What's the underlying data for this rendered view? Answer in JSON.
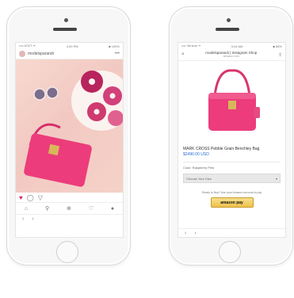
{
  "left_phone": {
    "status": {
      "carrier": "•••• AT&T ᯤ",
      "time": "4:20 PM",
      "battery": "■ 100%"
    },
    "header": {
      "username": "modelsparandi",
      "more": "•••"
    },
    "actions": {
      "like": "♥",
      "comment": "◯",
      "share": "▽"
    },
    "tabbar": [
      "⌂",
      "⚲",
      "⊕",
      "♡",
      "●"
    ],
    "nav": {
      "back": "‹",
      "forward": "›"
    }
  },
  "right_phone": {
    "status": {
      "carrier": "•••• Verizon ᯤ",
      "time": "9:44 AM",
      "battery": "■ 86%"
    },
    "header": {
      "close": "×",
      "title": "modelsparandi | Instagram Shop",
      "subtitle": "amazon.com",
      "share": "⇪"
    },
    "product": {
      "name": "MARK CROSS Pebble Grain Benchley Bag",
      "price": "$2490.00 USD"
    },
    "color_line": "Color: Raspberry Pink",
    "size_select": {
      "value": "Choose Your Size",
      "arrow": "▾"
    },
    "buy_note": "Ready to Buy? Use your Amazon account to pay",
    "pay_button": "amazon pay",
    "nav": {
      "back": "‹",
      "forward": "›"
    }
  },
  "colors": {
    "bag_pink": "#ec3c7b",
    "donut_pink": "#c8336b",
    "amazon_pay_yellow": "#f0c14b",
    "price_blue": "#2a6bd6",
    "like_red": "#e0245e"
  }
}
